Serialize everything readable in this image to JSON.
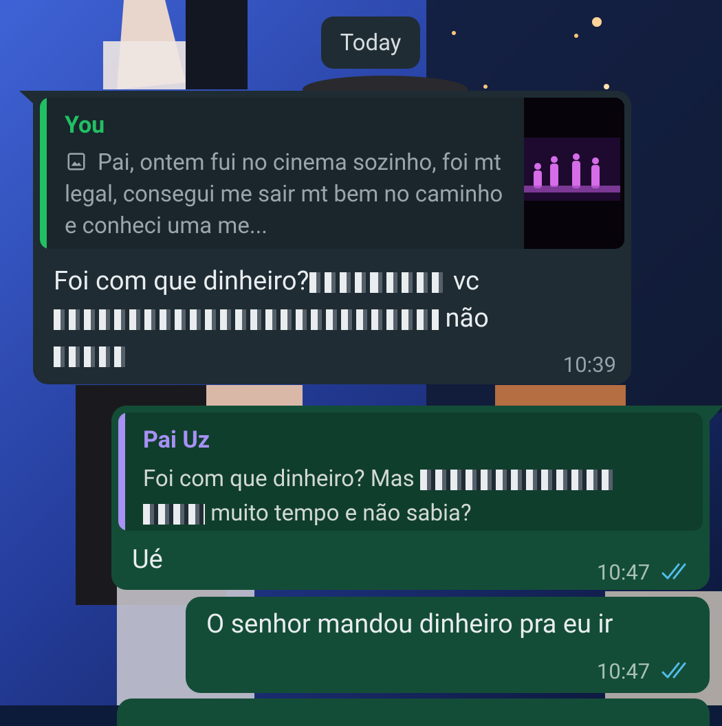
{
  "date_chip": "Today",
  "incoming": {
    "quote": {
      "author": "You",
      "text": "Pai, ontem fui no cinema sozinho, foi mt legal, consegui me sair mt bem no caminho e conheci uma me...",
      "icon": "image-icon"
    },
    "text_part1": "Foi com que dinheiro?",
    "text_part2": "vc",
    "text_part3": "não",
    "time": "10:39"
  },
  "outgoing1": {
    "quote": {
      "author": "Pai Uz",
      "text_line1": "Foi com que dinheiro? Mas",
      "text_line2": "muito tempo e não sabia?"
    },
    "text": "Ué",
    "time": "10:47",
    "status_icon": "double-check-read-icon"
  },
  "outgoing2": {
    "text": "O senhor mandou dinheiro pra eu ir",
    "time": "10:47",
    "status_icon": "double-check-read-icon"
  },
  "colors": {
    "incoming_bubble": "#1f2c33",
    "outgoing_bubble": "#144d37",
    "you_name": "#21c063",
    "contact_name": "#a791f5",
    "read_check": "#53bdeb"
  }
}
